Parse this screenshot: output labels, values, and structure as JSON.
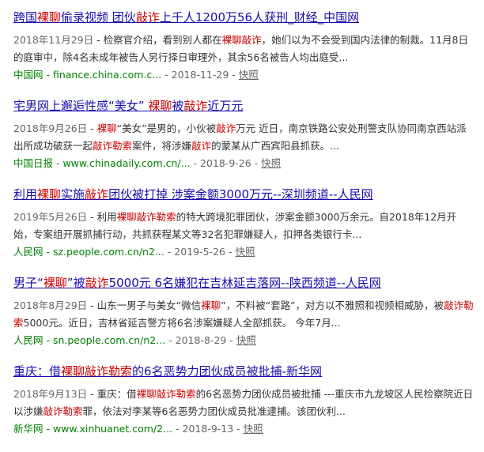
{
  "results": [
    {
      "title": [
        {
          "t": "跨国",
          "h": false
        },
        {
          "t": "裸聊",
          "h": true
        },
        {
          "t": "偷录视频 团伙",
          "h": false
        },
        {
          "t": "敲诈",
          "h": true
        },
        {
          "t": "上千人1200万56人获刑_财经_中国网",
          "h": false
        }
      ],
      "date": "2018年11月29日",
      "abstract": [
        {
          "t": " - 检察官介绍，看到别人都在",
          "h": false
        },
        {
          "t": "裸聊敲诈",
          "h": true
        },
        {
          "t": "，她们以为不会受到国内法律的制裁。11月8日的庭审中，除4名未成年被告人另行择日审理外，其余56名被告人均出庭受...",
          "h": false
        }
      ],
      "source": "中国网 - finance.china.com.c...",
      "meta_date": "2018-11-29",
      "snapshot": "快照"
    },
    {
      "title": [
        {
          "t": "宅男网上邂逅性感“美女” ",
          "h": false
        },
        {
          "t": "裸聊",
          "h": true
        },
        {
          "t": "被",
          "h": false
        },
        {
          "t": "敲诈",
          "h": true
        },
        {
          "t": "近万元",
          "h": false
        }
      ],
      "date": "2018年9月26日",
      "abstract": [
        {
          "t": " - ",
          "h": false
        },
        {
          "t": "裸聊",
          "h": true
        },
        {
          "t": "“美女”是男的，小伙被",
          "h": false
        },
        {
          "t": "敲诈",
          "h": true
        },
        {
          "t": "万元 近日，南京铁路公安处刑警支队协同南京西站派出所成功破获一起",
          "h": false
        },
        {
          "t": "敲诈勒索",
          "h": true
        },
        {
          "t": "案件，将涉嫌",
          "h": false
        },
        {
          "t": "敲诈",
          "h": true
        },
        {
          "t": "的蒙某从广西宾阳县抓获。...",
          "h": false
        }
      ],
      "source": "中国日报 - www.chinadaily.com.cn/...",
      "meta_date": "2018-9-26",
      "snapshot": "快照"
    },
    {
      "title": [
        {
          "t": "利用",
          "h": false
        },
        {
          "t": "裸聊",
          "h": true
        },
        {
          "t": "实施",
          "h": false
        },
        {
          "t": "敲诈",
          "h": true
        },
        {
          "t": "团伙被打掉 涉案金额3000万元--深圳频道--人民网",
          "h": false
        }
      ],
      "date": "2019年5月26日",
      "abstract": [
        {
          "t": " - 利用",
          "h": false
        },
        {
          "t": "裸聊敲诈勒索",
          "h": true
        },
        {
          "t": "的特大跨境犯罪团伙，涉案金额3000万余元。自2018年12月开始，专案组开展抓捕行动，共抓获程某文等32名犯罪嫌疑人，扣押各类银行卡...",
          "h": false
        }
      ],
      "source": "人民网 - sz.people.com.cn/n2...",
      "meta_date": "2019-5-26",
      "snapshot": "快照"
    },
    {
      "title": [
        {
          "t": "男子“",
          "h": false
        },
        {
          "t": "裸聊",
          "h": true
        },
        {
          "t": "”被",
          "h": false
        },
        {
          "t": "敲诈",
          "h": true
        },
        {
          "t": "5000元 6名嫌犯在吉林延吉落网--陕西频道--人民网",
          "h": false
        }
      ],
      "date": "2018年8月29日",
      "abstract": [
        {
          "t": " - 山东一男子与美女“微信",
          "h": false
        },
        {
          "t": "裸聊",
          "h": true
        },
        {
          "t": "”，不料被“套路”，对方以不雅照和视频相威胁，被",
          "h": false
        },
        {
          "t": "敲诈勒索",
          "h": true
        },
        {
          "t": "5000元。近日，吉林省延吉警方将6名涉案嫌疑人全部抓获。 今年7月...",
          "h": false
        }
      ],
      "source": "人民网 - sn.people.com.cn/n2...",
      "meta_date": "2018-8-29",
      "snapshot": "快照"
    },
    {
      "title": [
        {
          "t": "重庆：借",
          "h": false
        },
        {
          "t": "裸聊敲诈勒索",
          "h": true
        },
        {
          "t": "的6名恶势力团伙成员被批捕-新华网",
          "h": false
        }
      ],
      "date": "2018年9月13日",
      "abstract": [
        {
          "t": " - 重庆：借",
          "h": false
        },
        {
          "t": "裸聊敲诈勒索",
          "h": true
        },
        {
          "t": "的6名恶势力团伙成员被批捕 ---重庆市九龙坡区人民检察院近日以涉嫌",
          "h": false
        },
        {
          "t": "敲诈勒索",
          "h": true
        },
        {
          "t": "罪，依法对李某等6名恶势力团伙成员批准逮捕。该团伙利...",
          "h": false
        }
      ],
      "source": "新华网 - www.xinhuanet.com/2...",
      "meta_date": "2018-9-13",
      "snapshot": "快照"
    }
  ]
}
